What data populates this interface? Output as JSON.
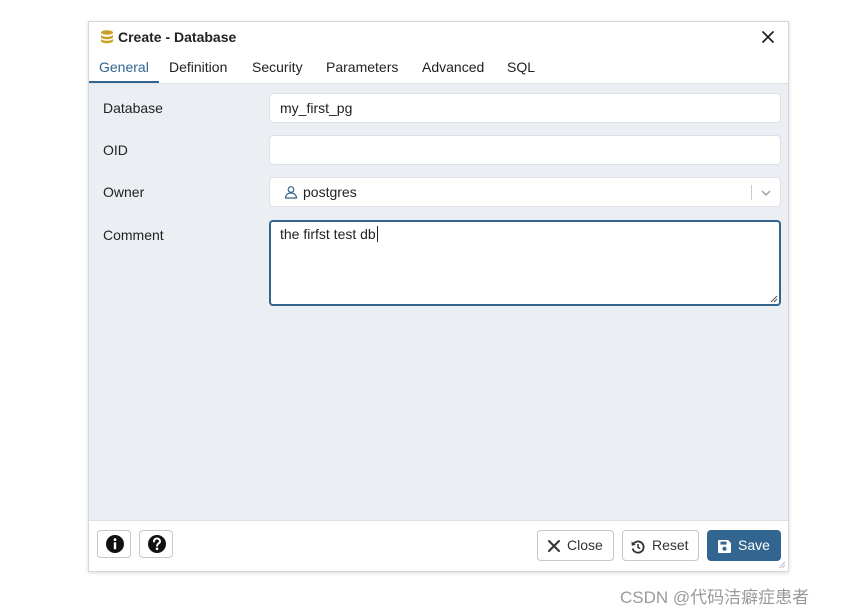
{
  "dialog": {
    "title": "Create - Database",
    "tabs": [
      {
        "label": "General",
        "active": true
      },
      {
        "label": "Definition"
      },
      {
        "label": "Security"
      },
      {
        "label": "Parameters"
      },
      {
        "label": "Advanced"
      },
      {
        "label": "SQL"
      }
    ],
    "form": {
      "database": {
        "label": "Database",
        "value": "my_first_pg"
      },
      "oid": {
        "label": "OID",
        "value": ""
      },
      "owner": {
        "label": "Owner",
        "value": "postgres"
      },
      "comment": {
        "label": "Comment",
        "value": "the firfst test db"
      }
    },
    "footer": {
      "close_label": "Close",
      "reset_label": "Reset",
      "save_label": "Save"
    }
  },
  "watermark": "CSDN @代码洁癖症患者",
  "colors": {
    "accent": "#326690",
    "content_bg": "#ebeef3",
    "title_icon": "#c9a227"
  },
  "icons": [
    "database-icon",
    "close-icon",
    "user-icon",
    "chevron-down-icon",
    "info-icon",
    "help-icon",
    "x-icon",
    "reset-icon",
    "save-icon"
  ]
}
